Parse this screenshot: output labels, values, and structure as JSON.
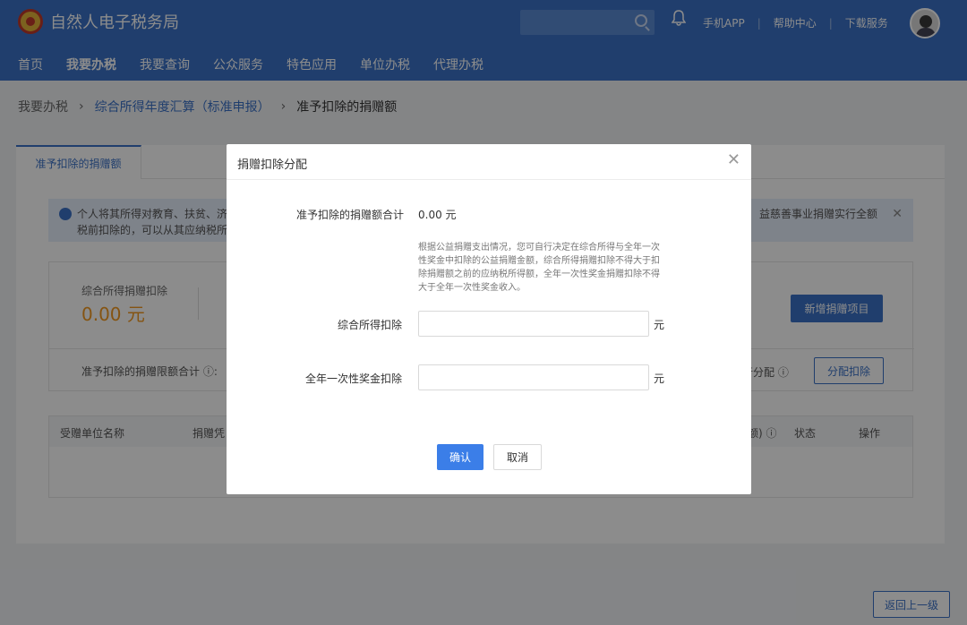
{
  "header": {
    "brand": "自然人电子税务局",
    "links": [
      "手机APP",
      "帮助中心",
      "下载服务"
    ],
    "nav": [
      "首页",
      "我要办税",
      "我要查询",
      "公众服务",
      "特色应用",
      "单位办税",
      "代理办税"
    ]
  },
  "breadcrumb": {
    "root": "我要办税",
    "middle": "综合所得年度汇算（标准申报）",
    "current": "准予扣除的捐赠额"
  },
  "page": {
    "tab": "准予扣除的捐赠额",
    "tip_line1": "个人将其所得对教育、扶贫、济",
    "tip_line2": "税前扣除的，可以从其应纳税所",
    "tip_right": "益慈善事业捐赠实行全额",
    "comp_label": "综合所得捐赠扣除",
    "comp_amount": "0.00 元",
    "add_button": "新增捐赠项目",
    "limit_label": "准予扣除的捐赠限额合计 ⓘ:",
    "assign_label": "行分配 ⓘ",
    "assign_button": "分配扣除",
    "columns": [
      "受赠单位名称",
      "捐赠凭",
      "额) ⓘ",
      "状态",
      "操作"
    ],
    "back_button": "返回上一级"
  },
  "modal": {
    "title": "捐赠扣除分配",
    "total_label": "准予扣除的捐赠额合计",
    "total_value": "0.00 元",
    "note": "根据公益捐赠支出情况，您可自行决定在综合所得与全年一次性奖金中扣除的公益捐赠金额，综合所得捐赠扣除不得大于扣除捐赠额之前的应纳税所得额，全年一次性奖金捐赠扣除不得大于全年一次性奖金收入。",
    "field1_label": "综合所得扣除",
    "field1_value": "",
    "field2_label": "全年一次性奖金扣除",
    "field2_value": "",
    "unit": "元",
    "ok": "确认",
    "cancel": "取消"
  }
}
